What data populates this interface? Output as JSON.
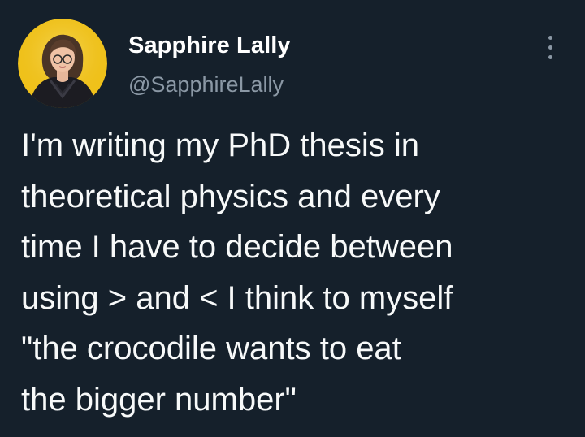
{
  "tweet": {
    "author": {
      "display_name": "Sapphire Lally",
      "handle": "@SapphireLally",
      "avatar_icon": "profile-photo"
    },
    "menu_icon": "more-vertical-icon",
    "text_lines": [
      "I'm writing my PhD thesis in",
      "theoretical physics and every",
      "time I have to decide between",
      "using > and < I think to myself",
      "\"the crocodile wants to eat",
      "the bigger number\""
    ]
  },
  "colors": {
    "background": "#15202b",
    "primary_text": "#ffffff",
    "secondary_text": "#8b98a5",
    "avatar_ring": "#f2c500"
  }
}
